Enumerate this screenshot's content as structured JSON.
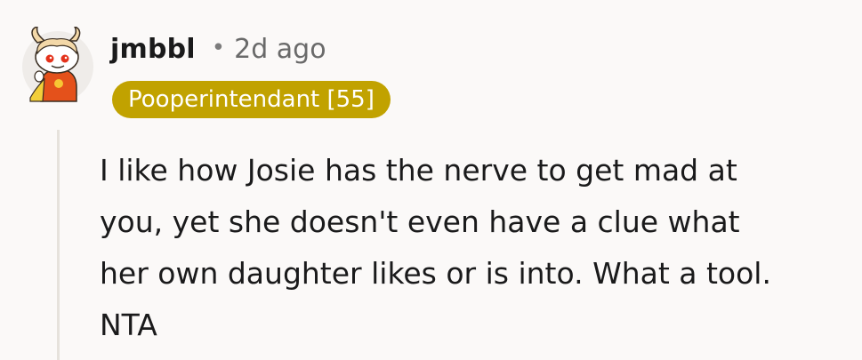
{
  "comment": {
    "author": "jmbbl",
    "separator": "•",
    "timestamp": "2d ago",
    "flair": "Pooperintendant [55]",
    "flair_color": "#c1a200",
    "avatar": "reddit-snoo-avatar-icon",
    "body_lines": [
      "I like how Josie has the nerve to get mad at",
      "you, yet she doesn't even have a clue what",
      "her own daughter likes or is into. What a tool.",
      "NTA"
    ]
  }
}
